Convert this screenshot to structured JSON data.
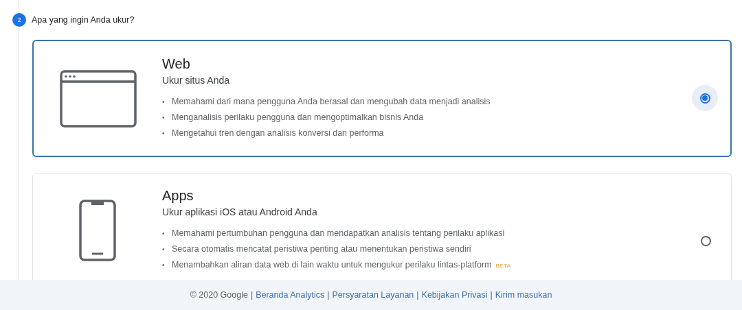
{
  "step": {
    "number": "2",
    "question": "Apa yang ingin Anda ukur?"
  },
  "options": [
    {
      "kind": "web",
      "title": "Web",
      "subtitle": "Ukur situs Anda",
      "selected": true,
      "bullets": [
        {
          "marker": "•",
          "text": "Memahami dari mana pengguna Anda berasal dan mengubah data menjadi analisis"
        },
        {
          "marker": "•",
          "text": "Menganalisis perilaku pengguna dan mengoptimalkan bisnis Anda"
        },
        {
          "marker": "•",
          "text": "Mengetahui tren dengan analisis konversi dan performa"
        }
      ]
    },
    {
      "kind": "apps",
      "title": "Apps",
      "subtitle": "Ukur aplikasi iOS atau Android Anda",
      "selected": false,
      "bullets": [
        {
          "marker": "•",
          "text": "Memahami pertumbuhan pengguna dan mendapatkan analisis tentang perilaku aplikasi"
        },
        {
          "marker": "•",
          "text": "Secara otomatis mencatat peristiwa penting atau menentukan peristiwa sendiri"
        },
        {
          "marker": "•",
          "text": "Menambahkan aliran data web di lain waktu untuk mengukur perilaku lintas-platform",
          "badge": "BETA"
        }
      ]
    }
  ],
  "footer": [
    {
      "kind": "text",
      "text": "© 2020 Google"
    },
    {
      "kind": "separator",
      "text": "|"
    },
    {
      "kind": "link",
      "text": "Beranda Analytics"
    },
    {
      "kind": "separator",
      "text": "|"
    },
    {
      "kind": "link",
      "text": "Persyaratan Layanan"
    },
    {
      "kind": "separator",
      "text": "|"
    },
    {
      "kind": "link",
      "text": "Kebijakan Privasi"
    },
    {
      "kind": "separator",
      "text": "|"
    },
    {
      "kind": "link",
      "text": "Kirim masukan"
    }
  ]
}
